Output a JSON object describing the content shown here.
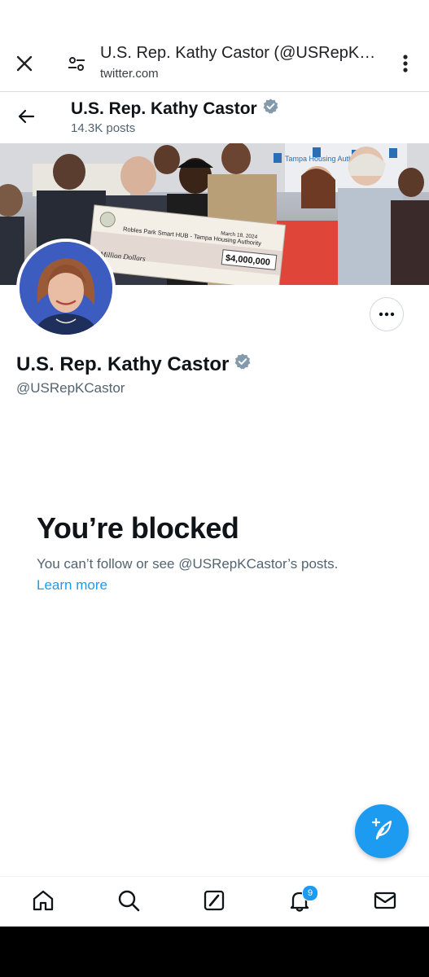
{
  "browser": {
    "title": "U.S. Rep. Kathy Castor (@USRepKCastor) / X",
    "url": "twitter.com"
  },
  "header": {
    "name": "U.S. Rep. Kathy Castor",
    "posts": "14.3K posts"
  },
  "banner": {
    "check_payee": "Robles Park Smart HUB - Tampa Housing Authority",
    "check_date": "March 18, 2024",
    "check_amount": "$4,000,000",
    "check_words": "Million Dollars",
    "sign_text": "Tampa Housing Authority"
  },
  "profile": {
    "name": "U.S. Rep. Kathy Castor",
    "handle": "@USRepKCastor"
  },
  "blocked": {
    "title": "You’re blocked",
    "message": "You can’t follow or see @USRepKCastor’s posts.",
    "link": "Learn more"
  },
  "nav": {
    "notifications_count": "9"
  },
  "colors": {
    "accent": "#1d9bf0",
    "verified": "#829aab",
    "secondary_text": "#536471"
  },
  "icons": [
    "close-icon",
    "tune-icon",
    "more-vert-icon",
    "back-arrow-icon",
    "verified-badge-icon",
    "more-horizontal-icon",
    "compose-post-icon",
    "home-icon",
    "search-icon",
    "grok-icon",
    "bell-icon",
    "mail-icon"
  ]
}
